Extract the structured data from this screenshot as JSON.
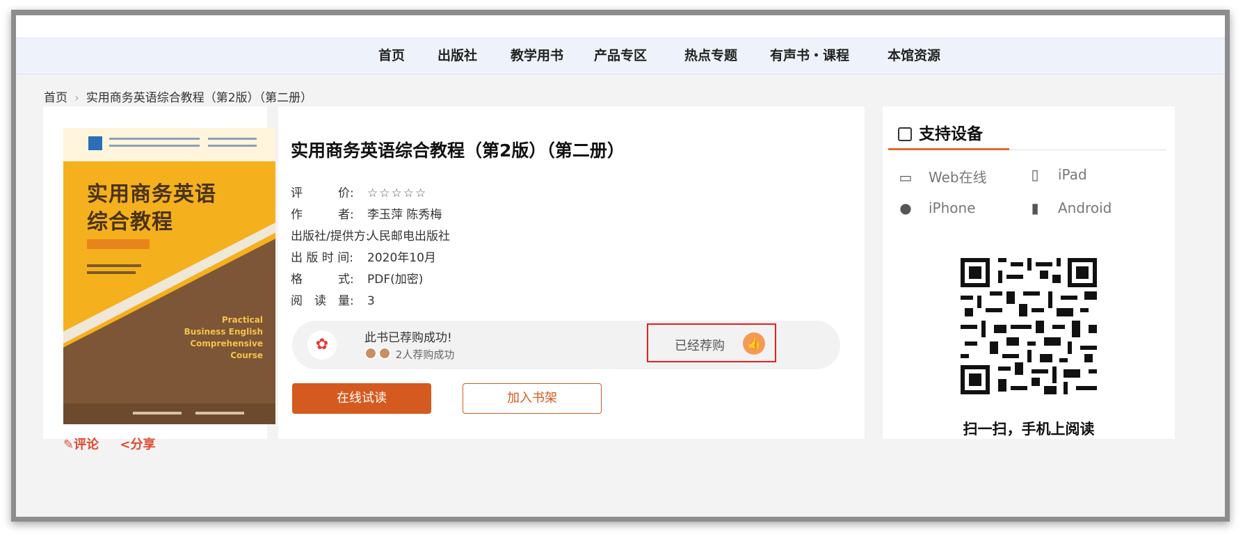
{
  "nav": {
    "items": [
      {
        "label": "首页"
      },
      {
        "label": "出版社"
      },
      {
        "label": "教学用书"
      },
      {
        "label": "产品专区"
      },
      {
        "label": "热点专题"
      },
      {
        "label": "有声书・课程"
      },
      {
        "label": "本馆资源"
      }
    ]
  },
  "breadcrumb": {
    "home": "首页",
    "current": "实用商务英语综合教程（第2版）（第二册）"
  },
  "cover": {
    "title_line1": "实用商务英语",
    "title_line2": "综合教程",
    "english": [
      "Practical",
      "Business English",
      "Comprehensive",
      "Course"
    ]
  },
  "left_actions": {
    "comment": "评论",
    "share": "分享"
  },
  "book": {
    "title": "实用商务英语综合教程（第2版）（第二册）",
    "rating_label": "评　　　价:",
    "rating_stars": "☆☆☆☆☆",
    "author_label": "作　　　者:",
    "author": "李玉萍 陈秀梅",
    "publisher_label": "出版社/提供方:",
    "publisher": "人民邮电出版社",
    "date_label": "出 版 时 间:",
    "date": "2020年10月",
    "format_label": "格　　　式:",
    "format": "PDF(加密)",
    "reads_label": "阅　读　量:",
    "reads": "3"
  },
  "recommend": {
    "message": "此书已荐购成功!",
    "count_text": "2人荐购成功",
    "button_label": "已经荐购"
  },
  "buttons": {
    "read_online": "在线试读",
    "add_shelf": "加入书架"
  },
  "support": {
    "title": "支持设备",
    "devices": {
      "web": "Web在线",
      "ipad": "iPad",
      "iphone": "iPhone",
      "android": "Android"
    },
    "qr_caption": "扫一扫，手机上阅读"
  },
  "colors": {
    "accent": "#d55a1f",
    "highlight_border": "#e02020",
    "nav_bg": "#eef3fb"
  }
}
